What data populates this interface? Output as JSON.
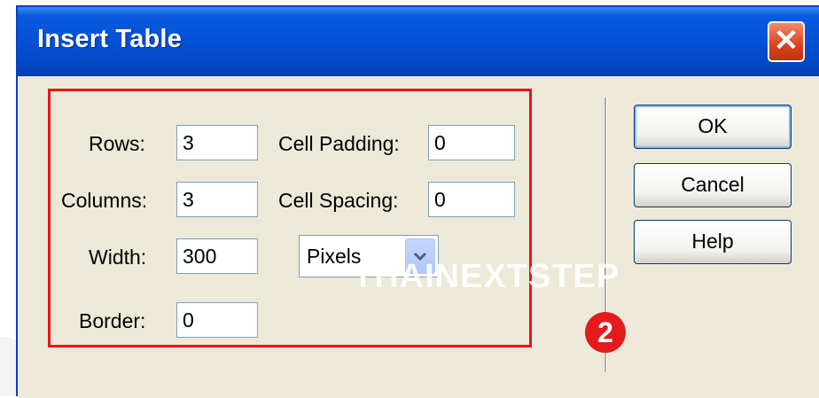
{
  "window": {
    "title": "Insert Table"
  },
  "fields": {
    "rows": {
      "label": "Rows:",
      "value": "3"
    },
    "columns": {
      "label": "Columns:",
      "value": "3"
    },
    "width": {
      "label": "Width:",
      "value": "300"
    },
    "width_unit": {
      "selected": "Pixels"
    },
    "border": {
      "label": "Border:",
      "value": "0"
    },
    "cell_padding": {
      "label": "Cell Padding:",
      "value": "0"
    },
    "cell_spacing": {
      "label": "Cell Spacing:",
      "value": "0"
    }
  },
  "buttons": {
    "ok": "OK",
    "cancel": "Cancel",
    "help": "Help"
  },
  "overlay": {
    "watermark": "THAINEXTSTEP",
    "step_badge": "2"
  },
  "colors": {
    "titlebar": "#0551d8",
    "highlight_box": "#e8141a",
    "dialog_bg": "#ece9d8",
    "badge": "#e31b1b"
  }
}
